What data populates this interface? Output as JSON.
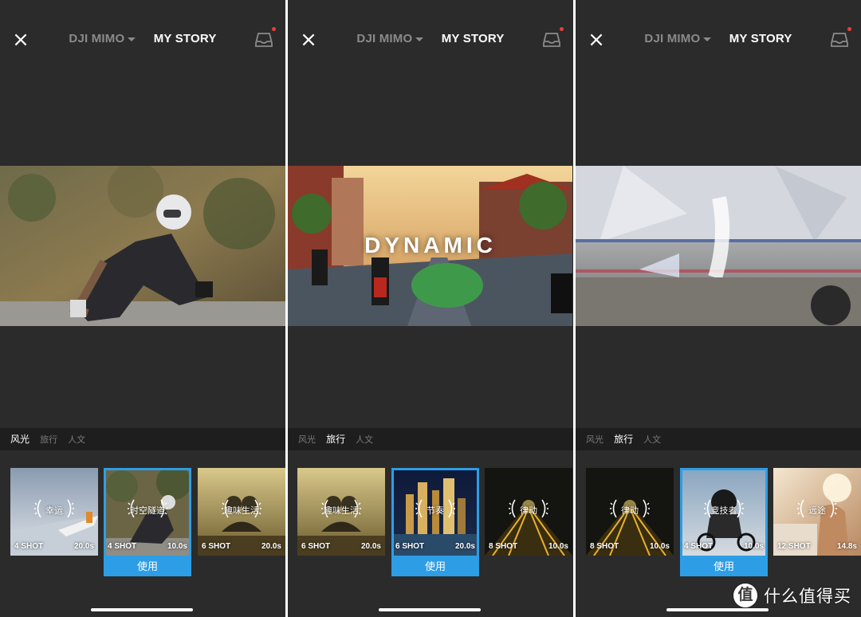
{
  "nav": {
    "close_icon": "×",
    "tab_dji_mimo": "DJI MIMO",
    "tab_my_story": "MY STORY"
  },
  "categories": [
    "风光",
    "旅行",
    "人文"
  ],
  "use_label": "使用",
  "colors": {
    "background": "#2b2b2b",
    "accent": "#2d9ee6",
    "category_bar": "#1e1e1e",
    "notification_dot": "#e5413a"
  },
  "screens": [
    {
      "active_category_index": 0,
      "preview_overlay_text": "",
      "templates": [
        {
          "name": "幸运",
          "shots": "4 SHOT",
          "duration": "20.0s",
          "selected": false
        },
        {
          "name": "时空隧道",
          "shots": "4 SHOT",
          "duration": "10.0s",
          "selected": true
        },
        {
          "name": "趣味生活",
          "shots": "6 SHOT",
          "duration": "20.0s",
          "selected": false
        }
      ]
    },
    {
      "active_category_index": 1,
      "preview_overlay_text": "DYNAMIC",
      "templates": [
        {
          "name": "趣味生活",
          "shots": "6 SHOT",
          "duration": "20.0s",
          "selected": false
        },
        {
          "name": "节奏",
          "shots": "6 SHOT",
          "duration": "20.0s",
          "selected": true
        },
        {
          "name": "律动",
          "shots": "8 SHOT",
          "duration": "10.0s",
          "selected": false
        }
      ]
    },
    {
      "active_category_index": 1,
      "preview_overlay_text": "",
      "templates": [
        {
          "name": "律动",
          "shots": "8 SHOT",
          "duration": "10.0s",
          "selected": false
        },
        {
          "name": "竞技者",
          "shots": "4 SHOT",
          "duration": "10.0s",
          "selected": true
        },
        {
          "name": "远途",
          "shots": "12 SHOT",
          "duration": "14.8s",
          "selected": false
        }
      ]
    }
  ],
  "watermark": {
    "icon_glyph": "值",
    "text": "什么值得买"
  }
}
